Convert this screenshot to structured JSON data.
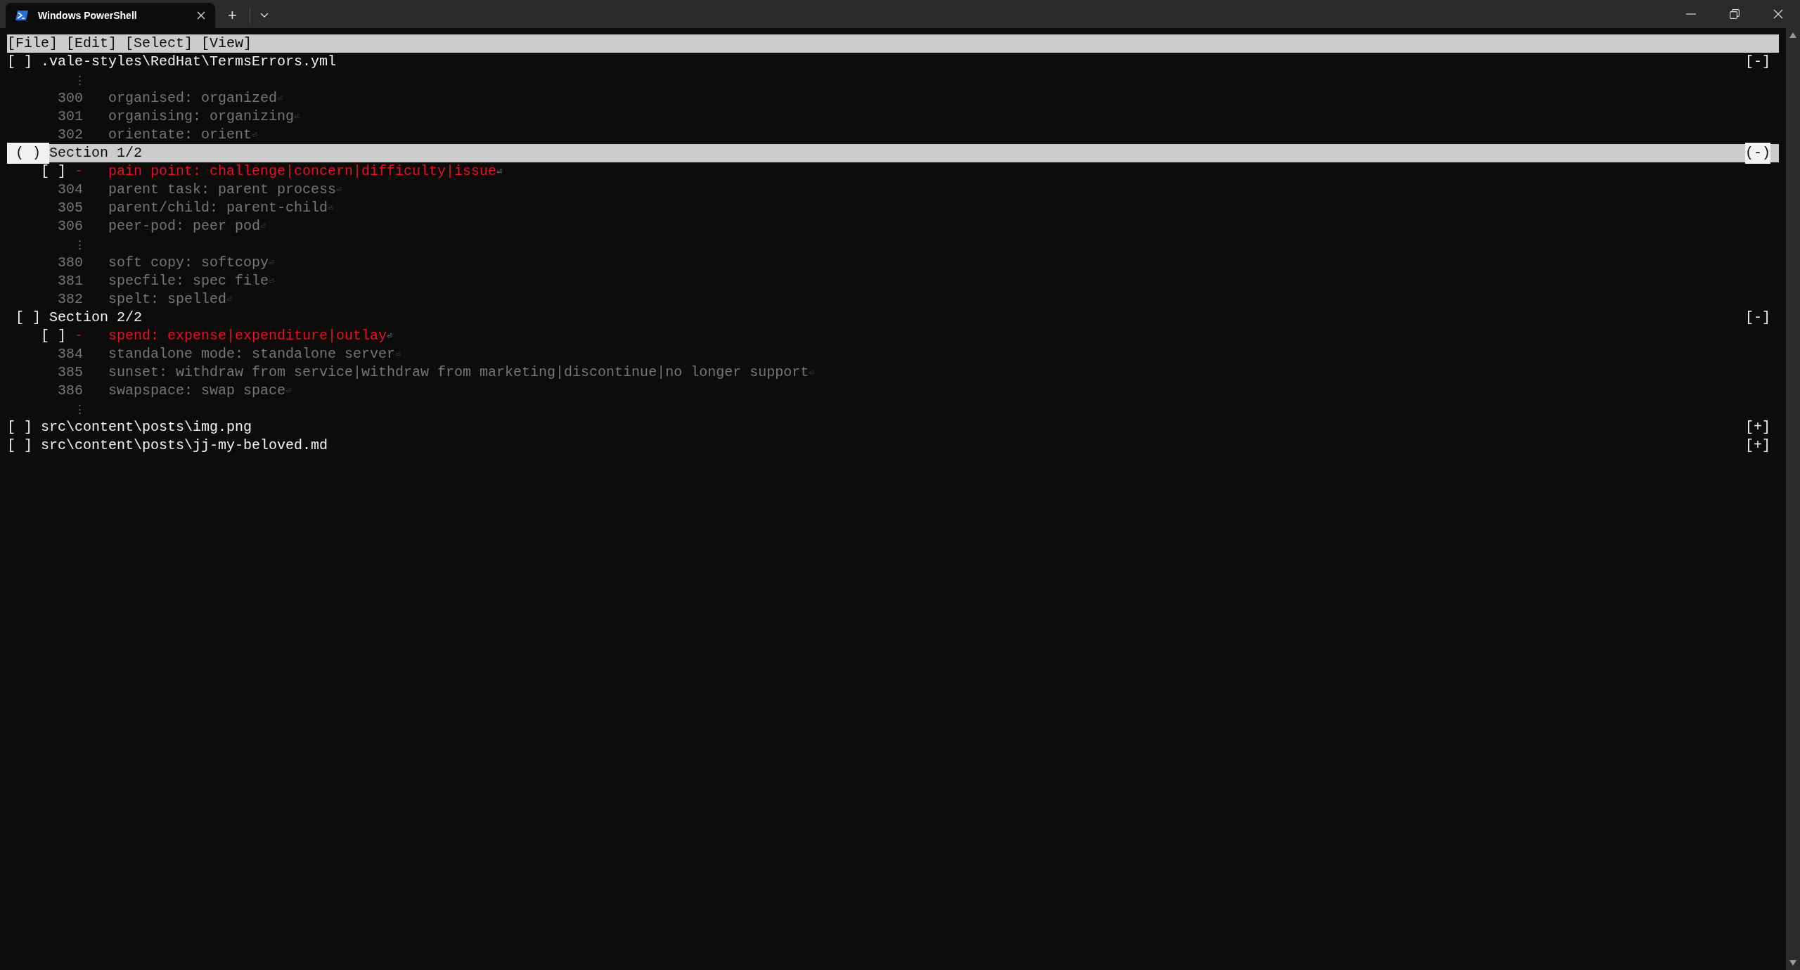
{
  "window": {
    "tab_title": "Windows PowerShell",
    "new_tab": "+"
  },
  "menu": [
    "[File]",
    "[Edit]",
    "[Select]",
    "[View]"
  ],
  "files": [
    {
      "checkbox": "[ ]",
      "path": ".vale-styles\\RedHat\\TermsErrors.yml",
      "toggle": "[-]",
      "selected": false,
      "checked": false,
      "lines": [
        {
          "kind": "ellipsis",
          "text": "⋮"
        },
        {
          "kind": "context",
          "number": "300",
          "text": "organised: organized",
          "eol": "⏎"
        },
        {
          "kind": "context",
          "number": "301",
          "text": "organising: organizing",
          "eol": "⏎"
        },
        {
          "kind": "context",
          "number": "302",
          "text": "orientate: orient",
          "eol": "⏎"
        },
        {
          "kind": "section",
          "checkbox": "( )",
          "label": "Section 1/2",
          "toggle": "(-)",
          "selected": true,
          "checked": false
        },
        {
          "kind": "change",
          "checkbox": "[ ]",
          "checked": false,
          "sign": "-",
          "text": "pain point: challenge|concern|difficulty|issue",
          "eol": "⏎"
        },
        {
          "kind": "context",
          "number": "304",
          "text": "parent task: parent process",
          "eol": "⏎"
        },
        {
          "kind": "context",
          "number": "305",
          "text": "parent/child: parent-child",
          "eol": "⏎"
        },
        {
          "kind": "context",
          "number": "306",
          "text": "peer-pod: peer pod",
          "eol": "⏎"
        },
        {
          "kind": "ellipsis",
          "text": "⋮"
        },
        {
          "kind": "context",
          "number": "380",
          "text": "soft copy: softcopy",
          "eol": "⏎"
        },
        {
          "kind": "context",
          "number": "381",
          "text": "specfile: spec file",
          "eol": "⏎"
        },
        {
          "kind": "context",
          "number": "382",
          "text": "spelt: spelled",
          "eol": "⏎"
        },
        {
          "kind": "section",
          "checkbox": "[ ]",
          "label": "Section 2/2",
          "toggle": "[-]",
          "selected": false,
          "checked": false
        },
        {
          "kind": "change",
          "checkbox": "[ ]",
          "checked": false,
          "sign": "-",
          "text": "spend: expense|expenditure|outlay",
          "eol": "⏎"
        },
        {
          "kind": "context",
          "number": "384",
          "text": "standalone mode: standalone server",
          "eol": "⏎"
        },
        {
          "kind": "context",
          "number": "385",
          "text": "sunset: withdraw from service|withdraw from marketing|discontinue|no longer support",
          "eol": "⏎"
        },
        {
          "kind": "context",
          "number": "386",
          "text": "swapspace: swap space",
          "eol": "⏎"
        },
        {
          "kind": "ellipsis",
          "text": "⋮"
        }
      ]
    },
    {
      "checkbox": "[ ]",
      "path": "src\\content\\posts\\img.png",
      "toggle": "[+]",
      "selected": false,
      "checked": false
    },
    {
      "checkbox": "[ ]",
      "path": "src\\content\\posts\\jj-my-beloved.md",
      "toggle": "[+]",
      "selected": false,
      "checked": false
    }
  ]
}
